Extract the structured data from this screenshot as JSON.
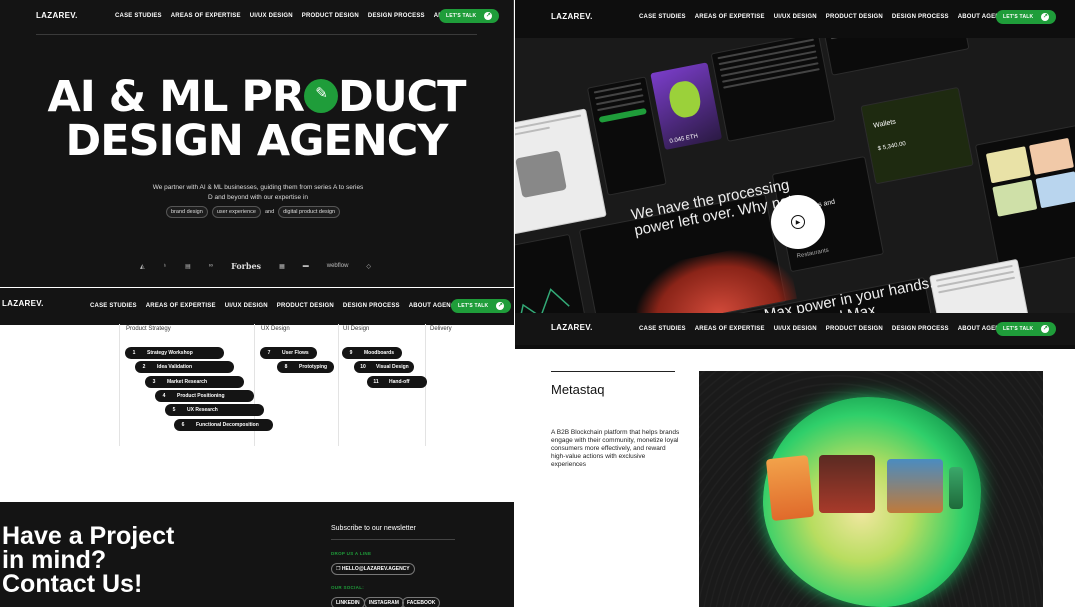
{
  "nav": {
    "logo": "LAZAREV.",
    "links": [
      "CASE STUDIES",
      "AREAS OF EXPERTISE",
      "UI/UX DESIGN",
      "PRODUCT DESIGN",
      "DESIGN PROCESS",
      "ABOUT AGENCY"
    ],
    "cta": "LET'S TALK",
    "cta_icon": "arrow-icon"
  },
  "hero": {
    "line1_a": "AI & ML PR",
    "line1_b": "DUCT",
    "line2": "DESIGN AGENCY",
    "subtitle": "We partner with AI & ML businesses, guiding them from series A to series D and beyond with our expertise in",
    "tags": [
      "brand design",
      "user experience",
      "and",
      "digital product design"
    ],
    "client_logos": [
      "webflow",
      "Forbes"
    ],
    "accent": "#1f9d3a"
  },
  "showcase": {
    "text1": "We have the processing power left over. Why not",
    "text2": "Max power in your hands. Max control Max",
    "eth": "0.045 ETH",
    "widget1": "Collections and products",
    "widget2": "Wallets",
    "widget3": "Restaurants",
    "price": "$ 5,340.00",
    "play_icon": "play-icon"
  },
  "process": {
    "columns": [
      "Product Strategy",
      "UX Design",
      "UI Design",
      "Delivery"
    ],
    "strategy": [
      {
        "n": "1",
        "t": "Strategy Workshop"
      },
      {
        "n": "2",
        "t": "Idea Validation"
      },
      {
        "n": "3",
        "t": "Market Research"
      },
      {
        "n": "4",
        "t": "Product Positioning"
      },
      {
        "n": "5",
        "t": "UX Research"
      },
      {
        "n": "6",
        "t": "Functional Decomposition"
      }
    ],
    "ux": [
      {
        "n": "7",
        "t": "User Flows"
      },
      {
        "n": "8",
        "t": "Prototyping"
      }
    ],
    "ui": [
      {
        "n": "9",
        "t": "Moodboards"
      },
      {
        "n": "10",
        "t": "Visual Design"
      },
      {
        "n": "11",
        "t": "Hand-off"
      }
    ]
  },
  "contact": {
    "line1": "Have a Project",
    "line2": "in mind?",
    "line3": "Contact Us!",
    "newsletter": "Subscribe to our newsletter",
    "drop_label": "DROP US A LINE",
    "email": "HELLO@LAZAREV.AGENCY",
    "social_label": "OUR SOCIAL:",
    "socials": [
      "LINKEDIN",
      "INSTAGRAM",
      "FACEBOOK"
    ]
  },
  "case": {
    "title": "Metastaq",
    "description": "A B2B Blockchain platform that helps brands engage with their community, monetize loyal consumers more effectively, and reward high-value actions with exclusive experiences"
  }
}
